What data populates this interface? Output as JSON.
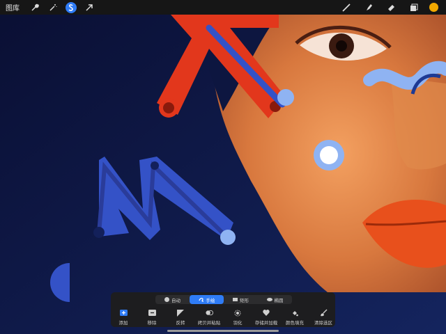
{
  "toolbar": {
    "gallery_label": "图库",
    "left_tools": [
      "wrench-icon",
      "magic-wand-icon",
      "selection-icon",
      "move-arrow-icon"
    ],
    "right_tools": [
      "brush-icon",
      "smudge-icon",
      "eraser-icon",
      "layers-icon"
    ],
    "current_color": "#f2a900"
  },
  "selection": {
    "modes": [
      {
        "label": "自动",
        "icon": "auto-icon",
        "active": false
      },
      {
        "label": "手绘",
        "icon": "freehand-icon",
        "active": true
      },
      {
        "label": "矩形",
        "icon": "rectangle-icon",
        "active": false
      },
      {
        "label": "椭圆",
        "icon": "ellipse-icon",
        "active": false
      }
    ],
    "actions": [
      {
        "label": "添加",
        "icon": "add-icon"
      },
      {
        "label": "移除",
        "icon": "remove-icon"
      },
      {
        "label": "反转",
        "icon": "invert-icon"
      },
      {
        "label": "拷贝并粘贴",
        "icon": "copy-paste-icon"
      },
      {
        "label": "羽化",
        "icon": "feather-icon"
      },
      {
        "label": "存储并加载",
        "icon": "save-load-icon"
      },
      {
        "label": "颜色填充",
        "icon": "color-fill-icon"
      },
      {
        "label": "清除选区",
        "icon": "clear-selection-icon"
      }
    ]
  },
  "colors": {
    "accent": "#2f7cf6",
    "canvas_background": "#0d1640",
    "shape_red": "#e2371c",
    "shape_blue": "#3452c7",
    "shape_light_blue": "#8fb3f2",
    "skin": "#d8783e",
    "lips": "#e8501c"
  }
}
